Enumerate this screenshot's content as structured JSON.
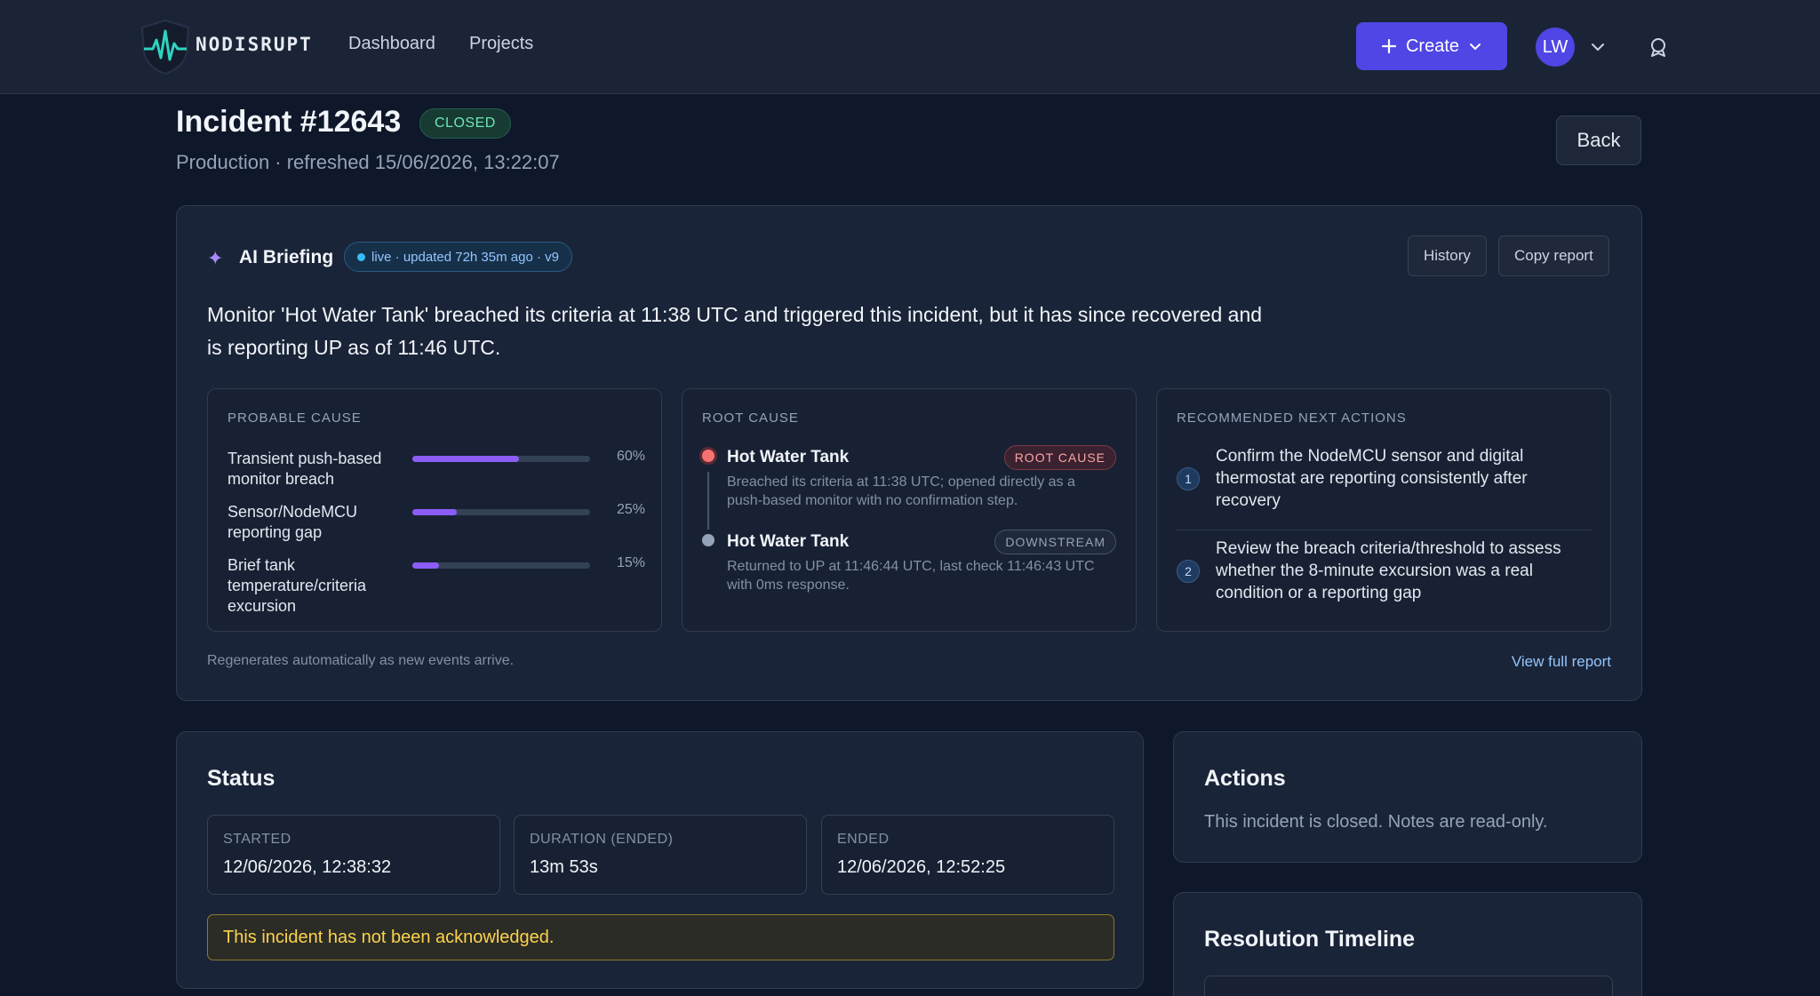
{
  "nav": {
    "brand": "NODISRUPT",
    "links": [
      "Dashboard",
      "Projects"
    ],
    "create_label": "Create",
    "avatar_initials": "LW"
  },
  "header": {
    "title": "Incident #12643",
    "badge": "CLOSED",
    "subtitle": "Production · refreshed 15/06/2026, 13:22:07",
    "back_label": "Back"
  },
  "briefing": {
    "title": "AI Briefing",
    "live_status": "live · updated 72h 35m ago · v9",
    "history_label": "History",
    "copy_label": "Copy report",
    "summary": "Monitor 'Hot Water Tank' breached its criteria at 11:38 UTC and triggered this incident, but it has since recovered and is reporting UP as of 11:46 UTC.",
    "probable_cause": {
      "label": "PROBABLE CAUSE",
      "items": [
        {
          "text": "Transient push-based monitor breach",
          "percent": 60,
          "percent_label": "60%"
        },
        {
          "text": "Sensor/NodeMCU reporting gap",
          "percent": 25,
          "percent_label": "25%"
        },
        {
          "text": "Brief tank temperature/criteria excursion",
          "percent": 15,
          "percent_label": "15%"
        }
      ]
    },
    "root_cause": {
      "label": "ROOT CAUSE",
      "items": [
        {
          "name": "Hot Water Tank",
          "badge": "ROOT CAUSE",
          "desc": "Breached its criteria at 11:38 UTC; opened directly as a push-based monitor with no confirmation step."
        },
        {
          "name": "Hot Water Tank",
          "badge": "DOWNSTREAM",
          "desc": "Returned to UP at 11:46:44 UTC, last check 11:46:43 UTC with 0ms response."
        }
      ]
    },
    "next_actions": {
      "label": "RECOMMENDED NEXT ACTIONS",
      "items": [
        {
          "num": "1",
          "text": "Confirm the NodeMCU sensor and digital thermostat are reporting consistently after recovery"
        },
        {
          "num": "2",
          "text": "Review the breach criteria/threshold to assess whether the 8-minute excursion was a real condition or a reporting gap"
        }
      ]
    },
    "footer_note": "Regenerates automatically as new events arrive.",
    "view_report_label": "View full report"
  },
  "status": {
    "title": "Status",
    "stats": [
      {
        "label": "STARTED",
        "value": "12/06/2026, 12:38:32"
      },
      {
        "label": "DURATION (ENDED)",
        "value": "13m 53s"
      },
      {
        "label": "ENDED",
        "value": "12/06/2026, 12:52:25"
      }
    ],
    "warning": "This incident has not been acknowledged."
  },
  "actions": {
    "title": "Actions",
    "text": "This incident is closed. Notes are read-only."
  },
  "timeline": {
    "title": "Resolution Timeline"
  },
  "colors": {
    "accent": "#4f46e5",
    "root_cause_dot": "#f87171",
    "downstream_dot": "#94a3b8",
    "bar_fill": "#8b5cf6"
  }
}
